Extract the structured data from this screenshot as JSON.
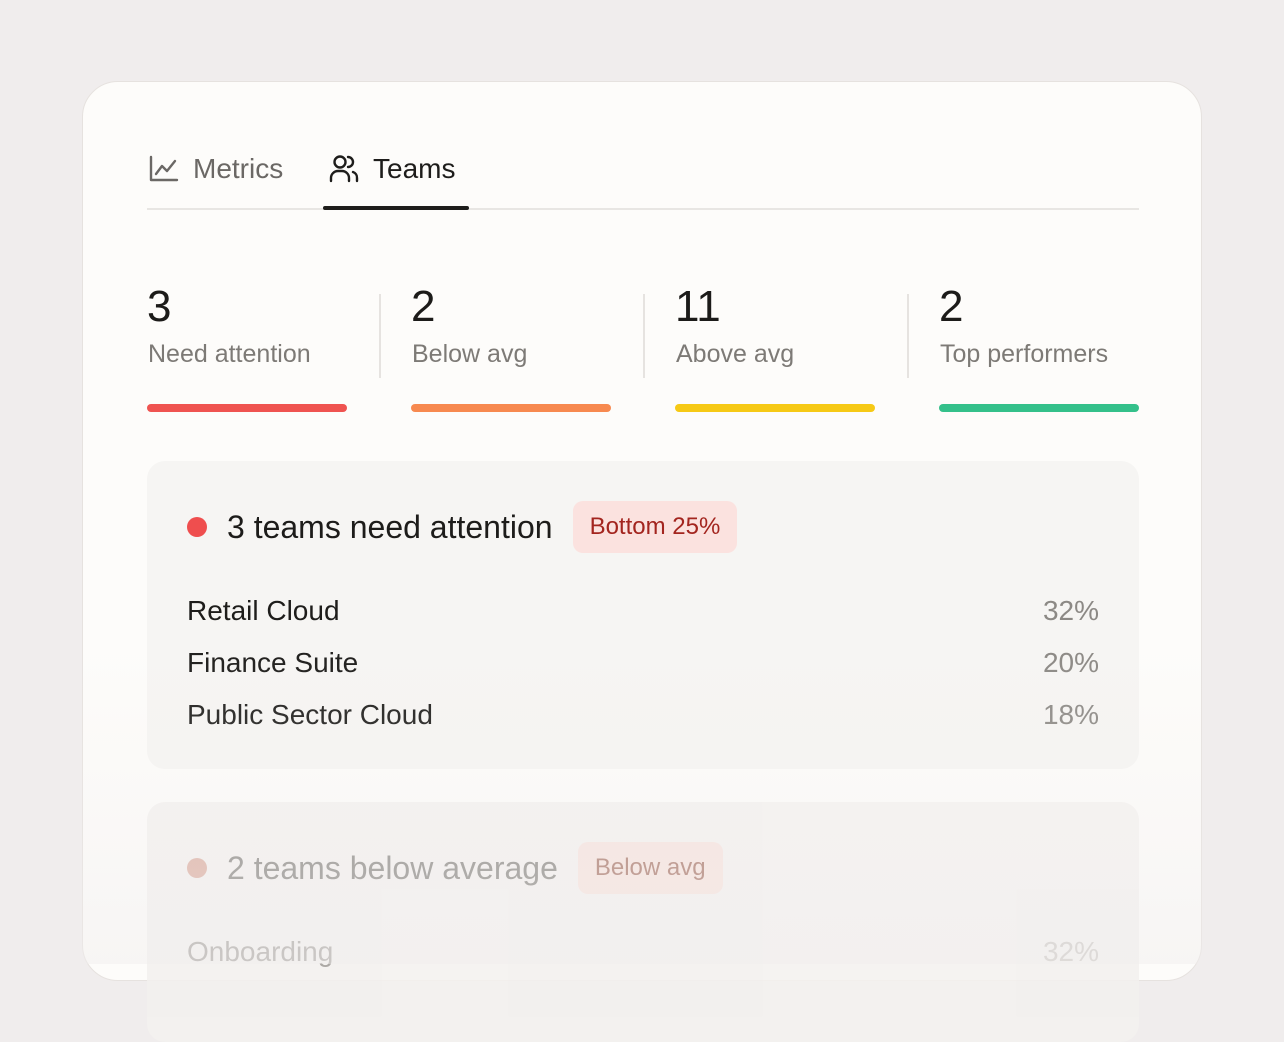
{
  "tabs": [
    {
      "label": "Metrics",
      "icon": "line-chart-icon"
    },
    {
      "label": "Teams",
      "icon": "users-icon"
    }
  ],
  "active_tab": "Teams",
  "stats": [
    {
      "value": "3",
      "label": "Need attention",
      "color": "#ef5350"
    },
    {
      "value": "2",
      "label": "Below avg",
      "color": "#f7894f"
    },
    {
      "value": "11",
      "label": "Above avg",
      "color": "#f6c915"
    },
    {
      "value": "2",
      "label": "Top performers",
      "color": "#34c08a"
    }
  ],
  "panels": [
    {
      "dot_color": "#ef4e4e",
      "title": "3 teams need attention",
      "badge": "Bottom 25%",
      "badge_bg": "#fbe2df",
      "badge_fg": "#a3251f",
      "rows": [
        {
          "name": "Retail Cloud",
          "pct": "32%"
        },
        {
          "name": "Finance Suite",
          "pct": "20%"
        },
        {
          "name": "Public Sector Cloud",
          "pct": "18%"
        }
      ]
    },
    {
      "dot_color": "#d9a89a",
      "title": "2 teams below average",
      "badge": "Below avg",
      "badge_bg": "#f7e1dc",
      "badge_fg": "#a0695a",
      "rows": [
        {
          "name": "Onboarding",
          "pct": "32%"
        }
      ]
    }
  ]
}
